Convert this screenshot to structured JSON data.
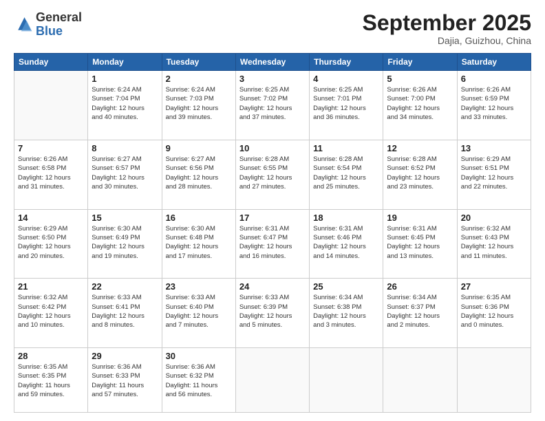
{
  "header": {
    "logo_general": "General",
    "logo_blue": "Blue",
    "month_title": "September 2025",
    "location": "Dajia, Guizhou, China"
  },
  "days_of_week": [
    "Sunday",
    "Monday",
    "Tuesday",
    "Wednesday",
    "Thursday",
    "Friday",
    "Saturday"
  ],
  "weeks": [
    [
      {
        "day": "",
        "info": ""
      },
      {
        "day": "1",
        "info": "Sunrise: 6:24 AM\nSunset: 7:04 PM\nDaylight: 12 hours\nand 40 minutes."
      },
      {
        "day": "2",
        "info": "Sunrise: 6:24 AM\nSunset: 7:03 PM\nDaylight: 12 hours\nand 39 minutes."
      },
      {
        "day": "3",
        "info": "Sunrise: 6:25 AM\nSunset: 7:02 PM\nDaylight: 12 hours\nand 37 minutes."
      },
      {
        "day": "4",
        "info": "Sunrise: 6:25 AM\nSunset: 7:01 PM\nDaylight: 12 hours\nand 36 minutes."
      },
      {
        "day": "5",
        "info": "Sunrise: 6:26 AM\nSunset: 7:00 PM\nDaylight: 12 hours\nand 34 minutes."
      },
      {
        "day": "6",
        "info": "Sunrise: 6:26 AM\nSunset: 6:59 PM\nDaylight: 12 hours\nand 33 minutes."
      }
    ],
    [
      {
        "day": "7",
        "info": "Sunrise: 6:26 AM\nSunset: 6:58 PM\nDaylight: 12 hours\nand 31 minutes."
      },
      {
        "day": "8",
        "info": "Sunrise: 6:27 AM\nSunset: 6:57 PM\nDaylight: 12 hours\nand 30 minutes."
      },
      {
        "day": "9",
        "info": "Sunrise: 6:27 AM\nSunset: 6:56 PM\nDaylight: 12 hours\nand 28 minutes."
      },
      {
        "day": "10",
        "info": "Sunrise: 6:28 AM\nSunset: 6:55 PM\nDaylight: 12 hours\nand 27 minutes."
      },
      {
        "day": "11",
        "info": "Sunrise: 6:28 AM\nSunset: 6:54 PM\nDaylight: 12 hours\nand 25 minutes."
      },
      {
        "day": "12",
        "info": "Sunrise: 6:28 AM\nSunset: 6:52 PM\nDaylight: 12 hours\nand 23 minutes."
      },
      {
        "day": "13",
        "info": "Sunrise: 6:29 AM\nSunset: 6:51 PM\nDaylight: 12 hours\nand 22 minutes."
      }
    ],
    [
      {
        "day": "14",
        "info": "Sunrise: 6:29 AM\nSunset: 6:50 PM\nDaylight: 12 hours\nand 20 minutes."
      },
      {
        "day": "15",
        "info": "Sunrise: 6:30 AM\nSunset: 6:49 PM\nDaylight: 12 hours\nand 19 minutes."
      },
      {
        "day": "16",
        "info": "Sunrise: 6:30 AM\nSunset: 6:48 PM\nDaylight: 12 hours\nand 17 minutes."
      },
      {
        "day": "17",
        "info": "Sunrise: 6:31 AM\nSunset: 6:47 PM\nDaylight: 12 hours\nand 16 minutes."
      },
      {
        "day": "18",
        "info": "Sunrise: 6:31 AM\nSunset: 6:46 PM\nDaylight: 12 hours\nand 14 minutes."
      },
      {
        "day": "19",
        "info": "Sunrise: 6:31 AM\nSunset: 6:45 PM\nDaylight: 12 hours\nand 13 minutes."
      },
      {
        "day": "20",
        "info": "Sunrise: 6:32 AM\nSunset: 6:43 PM\nDaylight: 12 hours\nand 11 minutes."
      }
    ],
    [
      {
        "day": "21",
        "info": "Sunrise: 6:32 AM\nSunset: 6:42 PM\nDaylight: 12 hours\nand 10 minutes."
      },
      {
        "day": "22",
        "info": "Sunrise: 6:33 AM\nSunset: 6:41 PM\nDaylight: 12 hours\nand 8 minutes."
      },
      {
        "day": "23",
        "info": "Sunrise: 6:33 AM\nSunset: 6:40 PM\nDaylight: 12 hours\nand 7 minutes."
      },
      {
        "day": "24",
        "info": "Sunrise: 6:33 AM\nSunset: 6:39 PM\nDaylight: 12 hours\nand 5 minutes."
      },
      {
        "day": "25",
        "info": "Sunrise: 6:34 AM\nSunset: 6:38 PM\nDaylight: 12 hours\nand 3 minutes."
      },
      {
        "day": "26",
        "info": "Sunrise: 6:34 AM\nSunset: 6:37 PM\nDaylight: 12 hours\nand 2 minutes."
      },
      {
        "day": "27",
        "info": "Sunrise: 6:35 AM\nSunset: 6:36 PM\nDaylight: 12 hours\nand 0 minutes."
      }
    ],
    [
      {
        "day": "28",
        "info": "Sunrise: 6:35 AM\nSunset: 6:35 PM\nDaylight: 11 hours\nand 59 minutes."
      },
      {
        "day": "29",
        "info": "Sunrise: 6:36 AM\nSunset: 6:33 PM\nDaylight: 11 hours\nand 57 minutes."
      },
      {
        "day": "30",
        "info": "Sunrise: 6:36 AM\nSunset: 6:32 PM\nDaylight: 11 hours\nand 56 minutes."
      },
      {
        "day": "",
        "info": ""
      },
      {
        "day": "",
        "info": ""
      },
      {
        "day": "",
        "info": ""
      },
      {
        "day": "",
        "info": ""
      }
    ]
  ]
}
